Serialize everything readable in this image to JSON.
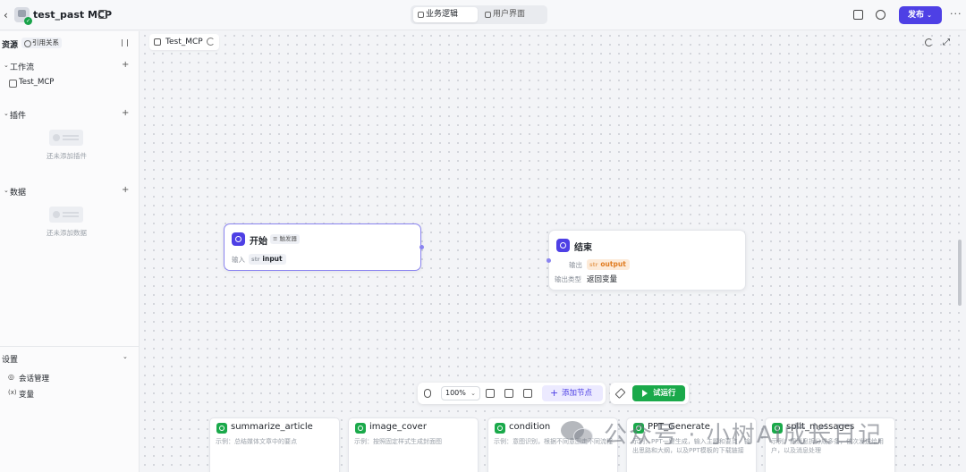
{
  "header": {
    "app_title": "test_past MCP",
    "modes": [
      "业务逻辑",
      "用户界面"
    ],
    "active_mode": "业务逻辑",
    "publish_label": "发布",
    "publish_color": "#4e40e5"
  },
  "sidebar": {
    "resources_title": "资源",
    "ref_label": "引用关系",
    "workflow_label": "工作流",
    "workflow_items": [
      "Test_MCP"
    ],
    "plugin_label": "插件",
    "plugin_empty": "还未添加插件",
    "data_label": "数据",
    "data_empty": "还未添加数据",
    "settings_label": "设置",
    "settings_items": [
      {
        "icon": "chat-icon",
        "label": "会话管理"
      },
      {
        "icon": "variable-icon",
        "label": "变量"
      }
    ]
  },
  "canvas": {
    "tab_label": "Test_MCP",
    "start_node": {
      "title": "开始",
      "badge": "≡ 触发器",
      "input_label": "输入",
      "input_type": "str",
      "input_var": "input"
    },
    "end_node": {
      "title": "结束",
      "output_label": "输出",
      "output_type": "str",
      "output_var": "output",
      "output_type_label": "输出类型",
      "output_type_value": "返回变量"
    },
    "toolbar": {
      "zoom": "100%",
      "add_node_label": "添加节点",
      "run_label": "试运行",
      "run_color": "#1aa94a"
    },
    "plugin_cards": [
      {
        "name": "summarize_article",
        "desc": "示例：总结媒体文章中的要点"
      },
      {
        "name": "image_cover",
        "desc": "示例：按照固定样式生成封面图"
      },
      {
        "name": "condition",
        "desc": "示例：意图识别，根据不同意图走不同流程"
      },
      {
        "name": "PPT_Generate",
        "desc": "示例：PPT一键生成，输入主题和要点，输出思路和大纲，以及PPT模板的下载链接"
      },
      {
        "name": "split_messages",
        "desc": "示例：把消息拆分成多条，依次发送给用户，以及消息处理"
      }
    ]
  },
  "watermark": {
    "text": "公众号 · 小树AI成长日记"
  }
}
